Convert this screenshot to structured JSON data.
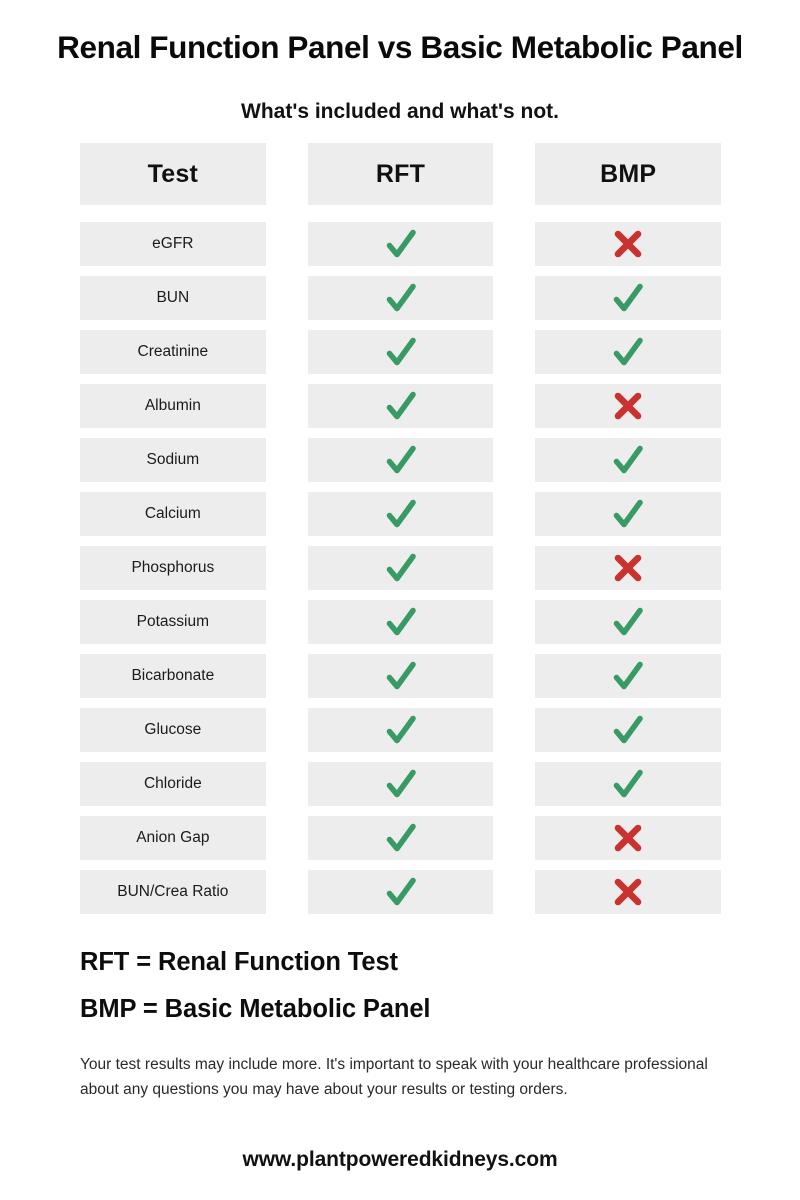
{
  "header": {
    "title": "Renal Function Panel vs Basic Metabolic Panel",
    "subtitle": "What's included and what's not."
  },
  "table": {
    "columns": [
      "Test",
      "RFT",
      "BMP"
    ],
    "rows": [
      {
        "test": "eGFR",
        "rft": "check",
        "bmp": "cross"
      },
      {
        "test": "BUN",
        "rft": "check",
        "bmp": "check"
      },
      {
        "test": "Creatinine",
        "rft": "check",
        "bmp": "check"
      },
      {
        "test": "Albumin",
        "rft": "check",
        "bmp": "cross"
      },
      {
        "test": "Sodium",
        "rft": "check",
        "bmp": "check"
      },
      {
        "test": "Calcium",
        "rft": "check",
        "bmp": "check"
      },
      {
        "test": "Phosphorus",
        "rft": "check",
        "bmp": "cross"
      },
      {
        "test": "Potassium",
        "rft": "check",
        "bmp": "check"
      },
      {
        "test": "Bicarbonate",
        "rft": "check",
        "bmp": "check"
      },
      {
        "test": "Glucose",
        "rft": "check",
        "bmp": "check"
      },
      {
        "test": "Chloride",
        "rft": "check",
        "bmp": "check"
      },
      {
        "test": "Anion Gap",
        "rft": "check",
        "bmp": "cross"
      },
      {
        "test": "BUN/Crea Ratio",
        "rft": "check",
        "bmp": "cross"
      }
    ]
  },
  "legend": {
    "rft": "RFT = Renal Function Test",
    "bmp": "BMP = Basic Metabolic Panel"
  },
  "disclaimer": "Your test results may include more. It's important to speak with your healthcare professional about any questions you may have about your results or testing orders.",
  "footer": {
    "site_url": "www.plantpoweredkidneys.com"
  },
  "colors": {
    "check": "#379b63",
    "cross": "#c9322e",
    "cell_background": "#ededed",
    "page_background": "#ffffff",
    "text": "#111111"
  }
}
